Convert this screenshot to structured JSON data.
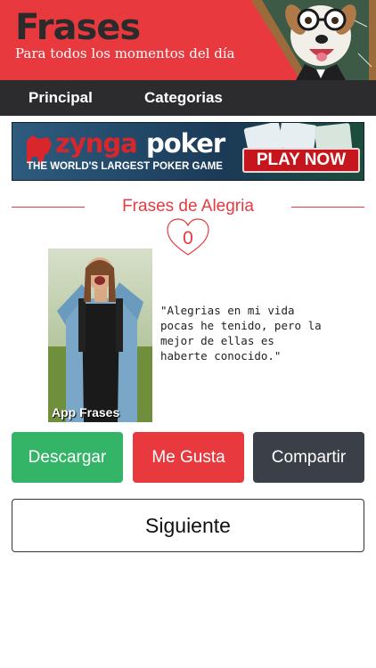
{
  "header": {
    "title": "Frases",
    "subtitle": "Para todos los momentos del día"
  },
  "nav": {
    "items": [
      {
        "label": "Principal"
      },
      {
        "label": "Categorias"
      }
    ]
  },
  "ad": {
    "brand_left": "zynga",
    "brand_right": "poker",
    "tagline": "THE WORLD'S LARGEST POKER GAME",
    "cta": "PLAY NOW"
  },
  "section": {
    "title": "Frases de Alegria",
    "likes": "0"
  },
  "photo": {
    "caption": "App Frases"
  },
  "quote": {
    "text": "\"Alegrias en mi vida\npocas he tenido, pero la\nmejor de ellas es\nhaberte conocido.\""
  },
  "actions": {
    "download": "Descargar",
    "like": "Me Gusta",
    "share": "Compartir",
    "next": "Siguiente"
  },
  "colors": {
    "brand_red": "#e8393f",
    "nav_dark": "#2c2c2e",
    "green": "#34b466",
    "button_dark": "#3b3f47"
  }
}
